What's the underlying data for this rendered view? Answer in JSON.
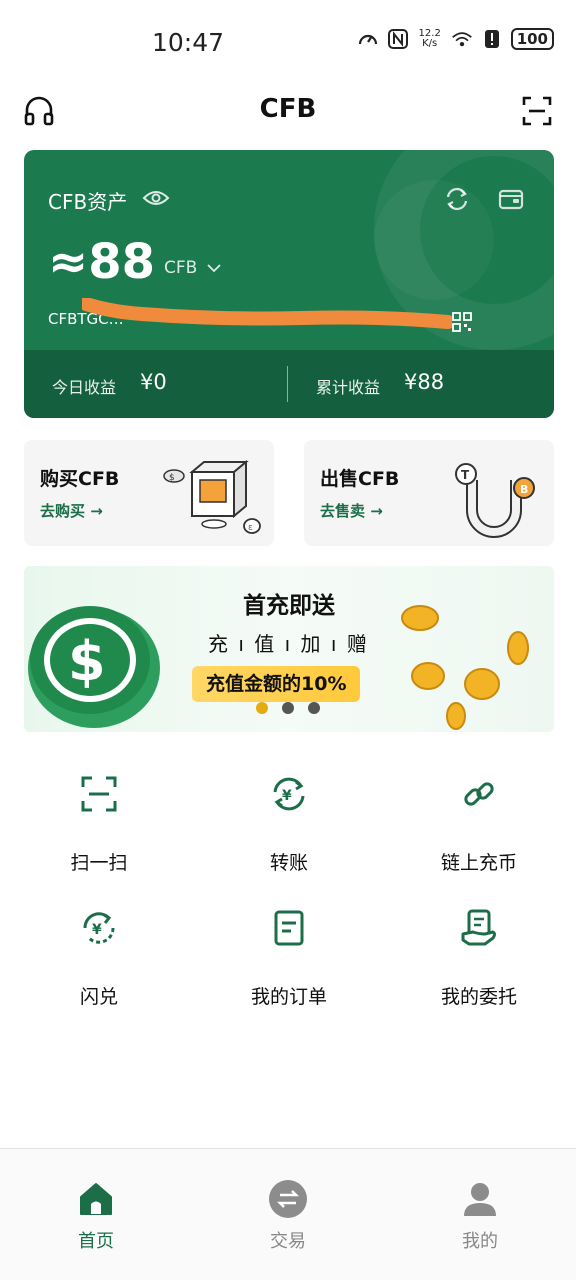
{
  "status_bar": {
    "time": "10:47",
    "net_speed_value": "12.2",
    "net_speed_unit": "K/s",
    "battery": "100"
  },
  "header": {
    "title": "CFB",
    "left_icon": "headset-icon",
    "right_icon": "scan-icon"
  },
  "asset_card": {
    "label": "CFB资产",
    "amount": "≈88",
    "unit": "CFB",
    "address": "CFBTGC…",
    "today_label": "今日收益",
    "today_value": "¥0",
    "total_label": "累计收益",
    "total_value": "¥88",
    "colors": {
      "card": "#1c7a4f",
      "bottom": "#14603e",
      "scribble": "#f08a3c"
    }
  },
  "trade": {
    "buy_title": "购买CFB",
    "buy_link": "去购买 →",
    "sell_title": "出售CFB",
    "sell_link": "去售卖 →"
  },
  "banner": {
    "title": "首充即送",
    "subtitle": "充 ı 值 ı 加 ı 赠",
    "highlight": "充值金额的10%",
    "dots": 3,
    "active_dot": 0
  },
  "features": [
    {
      "label": "扫一扫",
      "icon": "scan-icon"
    },
    {
      "label": "转账",
      "icon": "transfer-icon"
    },
    {
      "label": "链上充币",
      "icon": "chain-link-icon"
    },
    {
      "label": "闪兑",
      "icon": "flash-exchange-icon"
    },
    {
      "label": "我的订单",
      "icon": "order-icon"
    },
    {
      "label": "我的委托",
      "icon": "entrust-icon"
    }
  ],
  "bottom_nav": [
    {
      "label": "首页",
      "icon": "home-icon",
      "active": true
    },
    {
      "label": "交易",
      "icon": "exchange-icon",
      "active": false
    },
    {
      "label": "我的",
      "icon": "profile-icon",
      "active": false
    }
  ],
  "accent": "#1c6e49"
}
